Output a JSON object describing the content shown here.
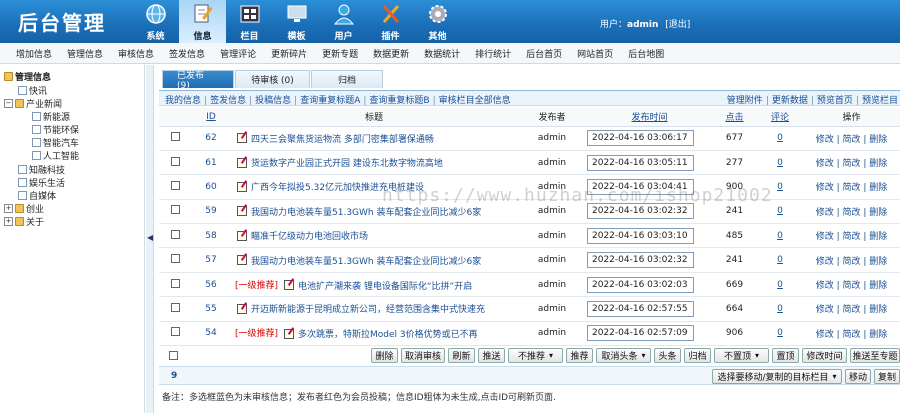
{
  "header": {
    "logo": "后台管理",
    "nav": [
      {
        "label": "系统",
        "icon": "globe-icon",
        "active": false
      },
      {
        "label": "信息",
        "icon": "document-edit-icon",
        "active": true
      },
      {
        "label": "栏目",
        "icon": "film-grid-icon",
        "active": false
      },
      {
        "label": "模板",
        "icon": "monitor-icon",
        "active": false
      },
      {
        "label": "用户",
        "icon": "user-icon",
        "active": false
      },
      {
        "label": "插件",
        "icon": "tools-icon",
        "active": false
      },
      {
        "label": "其他",
        "icon": "gear-icon",
        "active": false
      }
    ],
    "user_prefix": "用户：",
    "username": "admin",
    "logout": "[退出]"
  },
  "subnav": [
    "增加信息",
    "管理信息",
    "审核信息",
    "签发信息",
    "管理评论",
    "更新碎片",
    "更新专题",
    "数据更新",
    "数据统计",
    "排行统计",
    "后台首页",
    "网站首页",
    "后台地图"
  ],
  "sidebar": {
    "items": [
      {
        "label": "管理信息",
        "bold": true
      },
      {
        "label": "快讯"
      },
      {
        "label": "产业新闻"
      },
      {
        "label": "新能源"
      },
      {
        "label": "节能环保"
      },
      {
        "label": "智能汽车"
      },
      {
        "label": "人工智能"
      },
      {
        "label": "知融科技"
      },
      {
        "label": "娱乐生活"
      },
      {
        "label": "自媒体"
      },
      {
        "label": "创业"
      },
      {
        "label": "关于"
      }
    ]
  },
  "tabs": [
    "已发布 (9)",
    "待审核 (0)",
    "归档"
  ],
  "toolbar": {
    "left_links": [
      "我的信息",
      "签发信息",
      "投稿信息",
      "查询重复标题A",
      "查询重复标题B",
      "审核栏目全部信息"
    ],
    "right_links": [
      "管理附件",
      "更新数据",
      "预览首页",
      "预览栏目"
    ]
  },
  "table": {
    "headers": {
      "id": "ID",
      "title": "标题",
      "publisher": "发布者",
      "time": "发布时间",
      "clicks": "点击",
      "comments": "评论",
      "ops": "操作"
    },
    "op_labels": {
      "edit": "修改",
      "simple": "简改",
      "delete": "删除"
    },
    "rows": [
      {
        "id": "62",
        "prefix": "",
        "title": "四天三会聚焦货运物流 多部门密集部署保通畅",
        "publisher": "admin",
        "time": "2022-04-16 03:06:17",
        "clicks": "677",
        "comments": "0"
      },
      {
        "id": "61",
        "prefix": "",
        "title": "货运数字产业园正式开园 建设东北数字物流高地",
        "publisher": "admin",
        "time": "2022-04-16 03:05:11",
        "clicks": "277",
        "comments": "0"
      },
      {
        "id": "60",
        "prefix": "",
        "title": "广西今年拟投5.32亿元加快推进充电桩建设",
        "publisher": "admin",
        "time": "2022-04-16 03:04:41",
        "clicks": "900",
        "comments": "0"
      },
      {
        "id": "59",
        "prefix": "",
        "title": "我国动力电池装车量51.3GWh 装车配套企业同比减少6家",
        "publisher": "admin",
        "time": "2022-04-16 03:02:32",
        "clicks": "241",
        "comments": "0"
      },
      {
        "id": "58",
        "prefix": "",
        "title": "瞄准千亿级动力电池回收市场",
        "publisher": "admin",
        "time": "2022-04-16 03:03:10",
        "clicks": "485",
        "comments": "0"
      },
      {
        "id": "57",
        "prefix": "",
        "title": "我国动力电池装车量51.3GWh 装车配套企业同比减少6家",
        "publisher": "admin",
        "time": "2022-04-16 03:02:32",
        "clicks": "241",
        "comments": "0"
      },
      {
        "id": "56",
        "prefix": "[一级推荐]",
        "title": "电池扩产潮来袭 锂电设备国际化“比拼”开启",
        "publisher": "admin",
        "time": "2022-04-16 03:02:03",
        "clicks": "669",
        "comments": "0"
      },
      {
        "id": "55",
        "prefix": "",
        "title": "开迈斯新能源于昆明成立新公司，经营范围含集中式快速充",
        "publisher": "admin",
        "time": "2022-04-16 02:57:55",
        "clicks": "664",
        "comments": "0"
      },
      {
        "id": "54",
        "prefix": "[一级推荐]",
        "title": "多次跳票，特斯拉Model 3价格优势或已不再",
        "publisher": "admin",
        "time": "2022-04-16 02:57:09",
        "clicks": "906",
        "comments": "0"
      }
    ]
  },
  "actions": [
    "删除",
    "取消审核",
    "刷新",
    "推送",
    "不推荐",
    "推荐",
    "取消头条",
    "头条",
    "归档",
    "不置顶",
    "置顶",
    "修改时间",
    "推送至专题"
  ],
  "pager": {
    "count": "9",
    "move_select": "选择要移动/复制的目标栏目",
    "move": "移动",
    "copy": "复制"
  },
  "note": "备注：多选框蓝色为未审核信息；发布者红色为会员投稿；信息ID粗体为未生成,点击ID可刷新页面.",
  "watermark": "https://www.huzhan.com/ishop21002",
  "colors": {
    "header_blue": "#1a6fb8",
    "link_blue": "#1b4f93",
    "recommend_red": "#dd0000"
  }
}
